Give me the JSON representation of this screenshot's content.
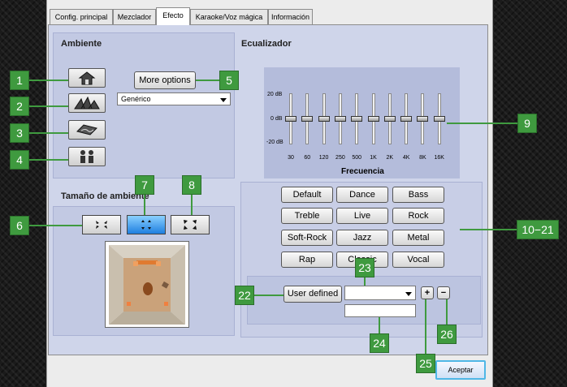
{
  "tabs": [
    {
      "label": "Config. principal"
    },
    {
      "label": "Mezclador"
    },
    {
      "label": "Efecto"
    },
    {
      "label": "Karaoke/Voz mágica"
    },
    {
      "label": "Información"
    }
  ],
  "ambiente": {
    "title": "Ambiente",
    "more_options": "More options",
    "preset": "Genérico"
  },
  "tamano": {
    "title": "Tamaño de ambiente"
  },
  "ecualizador": {
    "title": "Ecualizador",
    "db_top": "20 dB",
    "db_mid": "0 dB",
    "db_bottom": "-20 dB",
    "frequencies": [
      "30",
      "60",
      "120",
      "250",
      "500",
      "1K",
      "2K",
      "4K",
      "8K",
      "16K"
    ],
    "gains_db": [
      0,
      0,
      0,
      0,
      0,
      0,
      0,
      0,
      0,
      0
    ],
    "xlabel": "Frecuencia",
    "presets": [
      "Default",
      "Dance",
      "Bass",
      "Treble",
      "Live",
      "Rock",
      "Soft-Rock",
      "Jazz",
      "Metal",
      "Rap",
      "Classic",
      "Vocal"
    ],
    "user_defined": "User defined",
    "user_select": "",
    "user_name": ""
  },
  "footer": {
    "accept": "Aceptar"
  },
  "callouts": {
    "c1": "1",
    "c2": "2",
    "c3": "3",
    "c4": "4",
    "c5": "5",
    "c6": "6",
    "c7": "7",
    "c8": "8",
    "c9": "9",
    "c10": "10−21",
    "c22": "22",
    "c23": "23",
    "c24": "24",
    "c25": "25",
    "c26": "26"
  },
  "colors": {
    "callout": "#3f9a3f",
    "panel": "#c2c9e3",
    "active_size": "#1f7fe0",
    "accept_border": "#4fb7e6"
  }
}
